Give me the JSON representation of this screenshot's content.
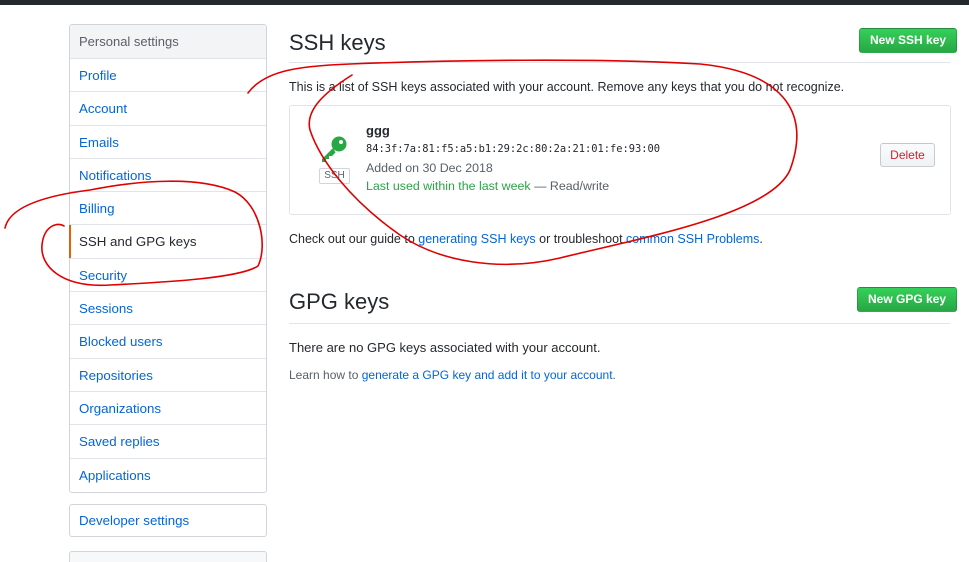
{
  "sidebar": {
    "header": "Personal settings",
    "items": [
      {
        "label": "Profile",
        "name": "sidebar-item-profile"
      },
      {
        "label": "Account",
        "name": "sidebar-item-account"
      },
      {
        "label": "Emails",
        "name": "sidebar-item-emails"
      },
      {
        "label": "Notifications",
        "name": "sidebar-item-notifications"
      },
      {
        "label": "Billing",
        "name": "sidebar-item-billing"
      },
      {
        "label": "SSH and GPG keys",
        "name": "sidebar-item-ssh-gpg-keys",
        "selected": true
      },
      {
        "label": "Security",
        "name": "sidebar-item-security"
      },
      {
        "label": "Sessions",
        "name": "sidebar-item-sessions"
      },
      {
        "label": "Blocked users",
        "name": "sidebar-item-blocked-users"
      },
      {
        "label": "Repositories",
        "name": "sidebar-item-repositories"
      },
      {
        "label": "Organizations",
        "name": "sidebar-item-organizations"
      },
      {
        "label": "Saved replies",
        "name": "sidebar-item-saved-replies"
      },
      {
        "label": "Applications",
        "name": "sidebar-item-applications"
      }
    ],
    "developer_settings": "Developer settings"
  },
  "ssh": {
    "title": "SSH keys",
    "new_button": "New SSH key",
    "description": "This is a list of SSH keys associated with your account. Remove any keys that you do not recognize.",
    "key": {
      "name": "ggg",
      "fingerprint": "84:3f:7a:81:f5:a5:b1:29:2c:80:2a:21:01:fe:93:00",
      "badge": "SSH",
      "added": "Added on 30 Dec 2018",
      "last_used": "Last used within the last week",
      "access": " — Read/write",
      "delete_label": "Delete"
    },
    "guide_prefix": "Check out our guide to ",
    "guide_link": "generating SSH keys",
    "guide_middle": " or troubleshoot ",
    "guide_link2": "common SSH Problems",
    "guide_suffix": "."
  },
  "gpg": {
    "title": "GPG keys",
    "new_button": "New GPG key",
    "empty": "There are no GPG keys associated with your account.",
    "learn_prefix": "Learn how to ",
    "learn_link": "generate a GPG key and add it to your account",
    "learn_suffix": "."
  },
  "colors": {
    "accent": "#e36209",
    "link": "#0366d6",
    "green": "#28a745",
    "danger": "#cb2431",
    "annotation": "#e00000"
  },
  "icons": {
    "key": "key-icon"
  }
}
